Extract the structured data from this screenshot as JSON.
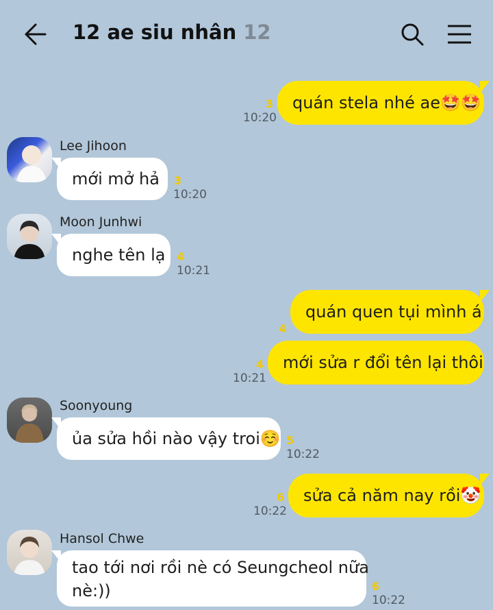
{
  "header": {
    "title": "12 ae siu nhân",
    "member_count": "12"
  },
  "messages": [
    {
      "text": "quán stela nhé ae🤩🤩",
      "unread": "3",
      "time": "10:20"
    },
    {
      "sender": "Lee Jihoon",
      "text": "mới mở hả",
      "unread": "3",
      "time": "10:20"
    },
    {
      "sender": "Moon Junhwi",
      "text": "nghe tên lạ",
      "unread": "4",
      "time": "10:21"
    },
    {
      "text": "quán quen tụi mình á",
      "unread": "4"
    },
    {
      "text": "mới sửa r đổi tên lại thôi",
      "unread": "4",
      "time": "10:21"
    },
    {
      "sender": "Soonyoung",
      "text": "ủa sửa hồi nào vậy troi☺️",
      "unread": "5",
      "time": "10:22"
    },
    {
      "text": "sửa cả năm nay rồi🤡",
      "unread": "6",
      "time": "10:22"
    },
    {
      "sender": "Hansol Chwe",
      "text_line1": "tao tới nơi rồi nè có Seungcheol nữa",
      "text_line2": "nè:))",
      "unread": "6",
      "time": "10:22"
    }
  ],
  "colors": {
    "background": "#b2c7d9",
    "my_bubble": "#fee500",
    "their_bubble": "#ffffff",
    "unread_count": "#f2c800"
  }
}
